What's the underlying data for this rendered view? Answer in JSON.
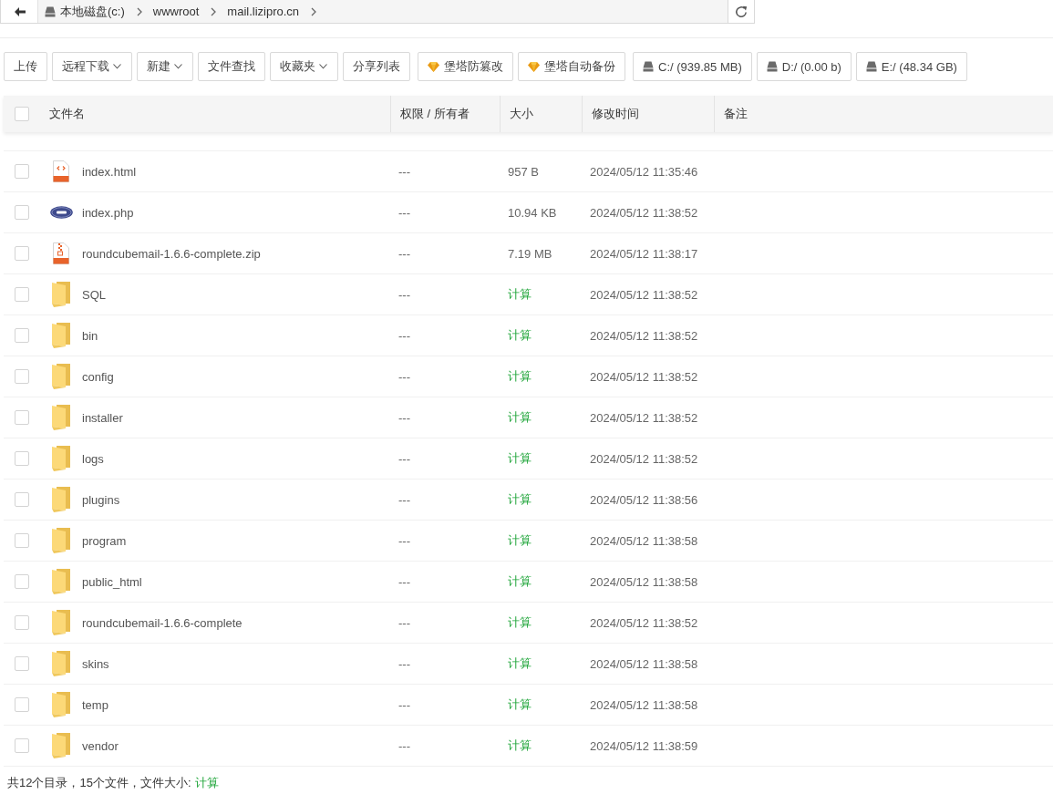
{
  "breadcrumb": {
    "items": [
      {
        "label": "本地磁盘(c:)",
        "kind": "drive"
      },
      {
        "label": "wwwroot",
        "kind": "folder"
      },
      {
        "label": "mail.lizipro.cn",
        "kind": "folder"
      }
    ]
  },
  "toolbar": {
    "buttons": [
      {
        "label": "上传",
        "kind": "plain"
      },
      {
        "label": "远程下载",
        "kind": "dropdown"
      },
      {
        "label": "新建",
        "kind": "dropdown"
      },
      {
        "label": "文件查找",
        "kind": "plain"
      },
      {
        "label": "收藏夹",
        "kind": "dropdown"
      },
      {
        "label": "分享列表",
        "kind": "plain"
      },
      {
        "label": "堡塔防篡改",
        "kind": "gem"
      },
      {
        "label": "堡塔自动备份",
        "kind": "gem"
      },
      {
        "label": "C:/ (939.85 MB)",
        "kind": "drive"
      },
      {
        "label": "D:/ (0.00 b)",
        "kind": "drive"
      },
      {
        "label": "E:/ (48.34 GB)",
        "kind": "drive"
      }
    ]
  },
  "table": {
    "select_all": {
      "checked": false
    },
    "columns": [
      "文件名",
      "权限 / 所有者",
      "大小",
      "修改时间",
      "备注"
    ],
    "rows": [
      {
        "name": "index.html",
        "kind": "html",
        "permission": "---",
        "size": "957 B",
        "modified": "2024/05/12 11:35:46",
        "checked": false
      },
      {
        "name": "index.php",
        "kind": "php",
        "permission": "---",
        "size": "10.94 KB",
        "modified": "2024/05/12 11:38:52",
        "checked": false
      },
      {
        "name": "roundcubemail-1.6.6-complete.zip",
        "kind": "zip",
        "permission": "---",
        "size": "7.19 MB",
        "modified": "2024/05/12 11:38:17",
        "checked": false
      },
      {
        "name": "SQL",
        "kind": "folder",
        "permission": "---",
        "size": "计算",
        "modified": "2024/05/12 11:38:52",
        "checked": false
      },
      {
        "name": "bin",
        "kind": "folder",
        "permission": "---",
        "size": "计算",
        "modified": "2024/05/12 11:38:52",
        "checked": false
      },
      {
        "name": "config",
        "kind": "folder",
        "permission": "---",
        "size": "计算",
        "modified": "2024/05/12 11:38:52",
        "checked": false
      },
      {
        "name": "installer",
        "kind": "folder",
        "permission": "---",
        "size": "计算",
        "modified": "2024/05/12 11:38:52",
        "checked": false
      },
      {
        "name": "logs",
        "kind": "folder",
        "permission": "---",
        "size": "计算",
        "modified": "2024/05/12 11:38:52",
        "checked": false
      },
      {
        "name": "plugins",
        "kind": "folder",
        "permission": "---",
        "size": "计算",
        "modified": "2024/05/12 11:38:56",
        "checked": false
      },
      {
        "name": "program",
        "kind": "folder",
        "permission": "---",
        "size": "计算",
        "modified": "2024/05/12 11:38:58",
        "checked": false
      },
      {
        "name": "public_html",
        "kind": "folder",
        "permission": "---",
        "size": "计算",
        "modified": "2024/05/12 11:38:58",
        "checked": false
      },
      {
        "name": "roundcubemail-1.6.6-complete",
        "kind": "folder",
        "permission": "---",
        "size": "计算",
        "modified": "2024/05/12 11:38:52",
        "checked": false
      },
      {
        "name": "skins",
        "kind": "folder",
        "permission": "---",
        "size": "计算",
        "modified": "2024/05/12 11:38:58",
        "checked": false
      },
      {
        "name": "temp",
        "kind": "folder",
        "permission": "---",
        "size": "计算",
        "modified": "2024/05/12 11:38:58",
        "checked": false
      },
      {
        "name": "vendor",
        "kind": "folder",
        "permission": "---",
        "size": "计算",
        "modified": "2024/05/12 11:38:59",
        "checked": false
      }
    ]
  },
  "footer": {
    "summary": "共12个目录，15个文件，文件大小:",
    "size_link": "计算"
  }
}
